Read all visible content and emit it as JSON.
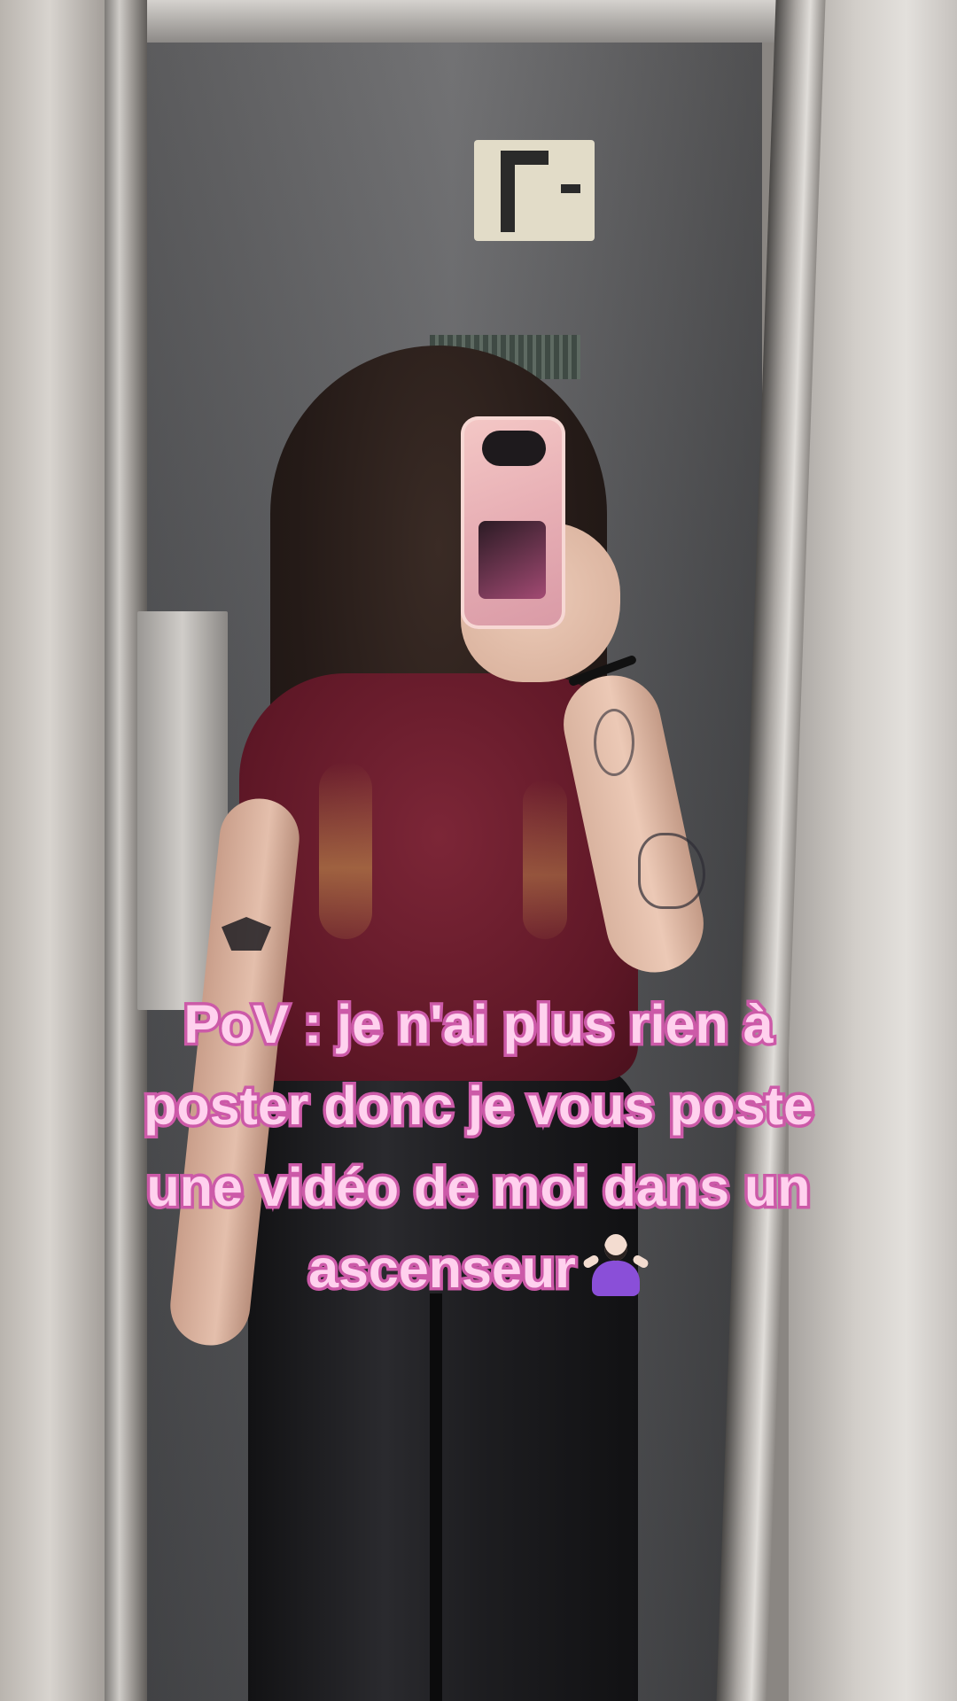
{
  "caption": {
    "lines": [
      "PoV : je n'ai plus rien à",
      "poster donc je vous poste",
      "une vidéo de moi dans un",
      "ascenseur"
    ],
    "emoji": "woman-shrugging-icon"
  },
  "colors": {
    "caption_fill": "#ffd1ee",
    "caption_stroke": "#cc5aa8",
    "shirt": "#6b1c2c",
    "door": "#5b5c5f"
  }
}
